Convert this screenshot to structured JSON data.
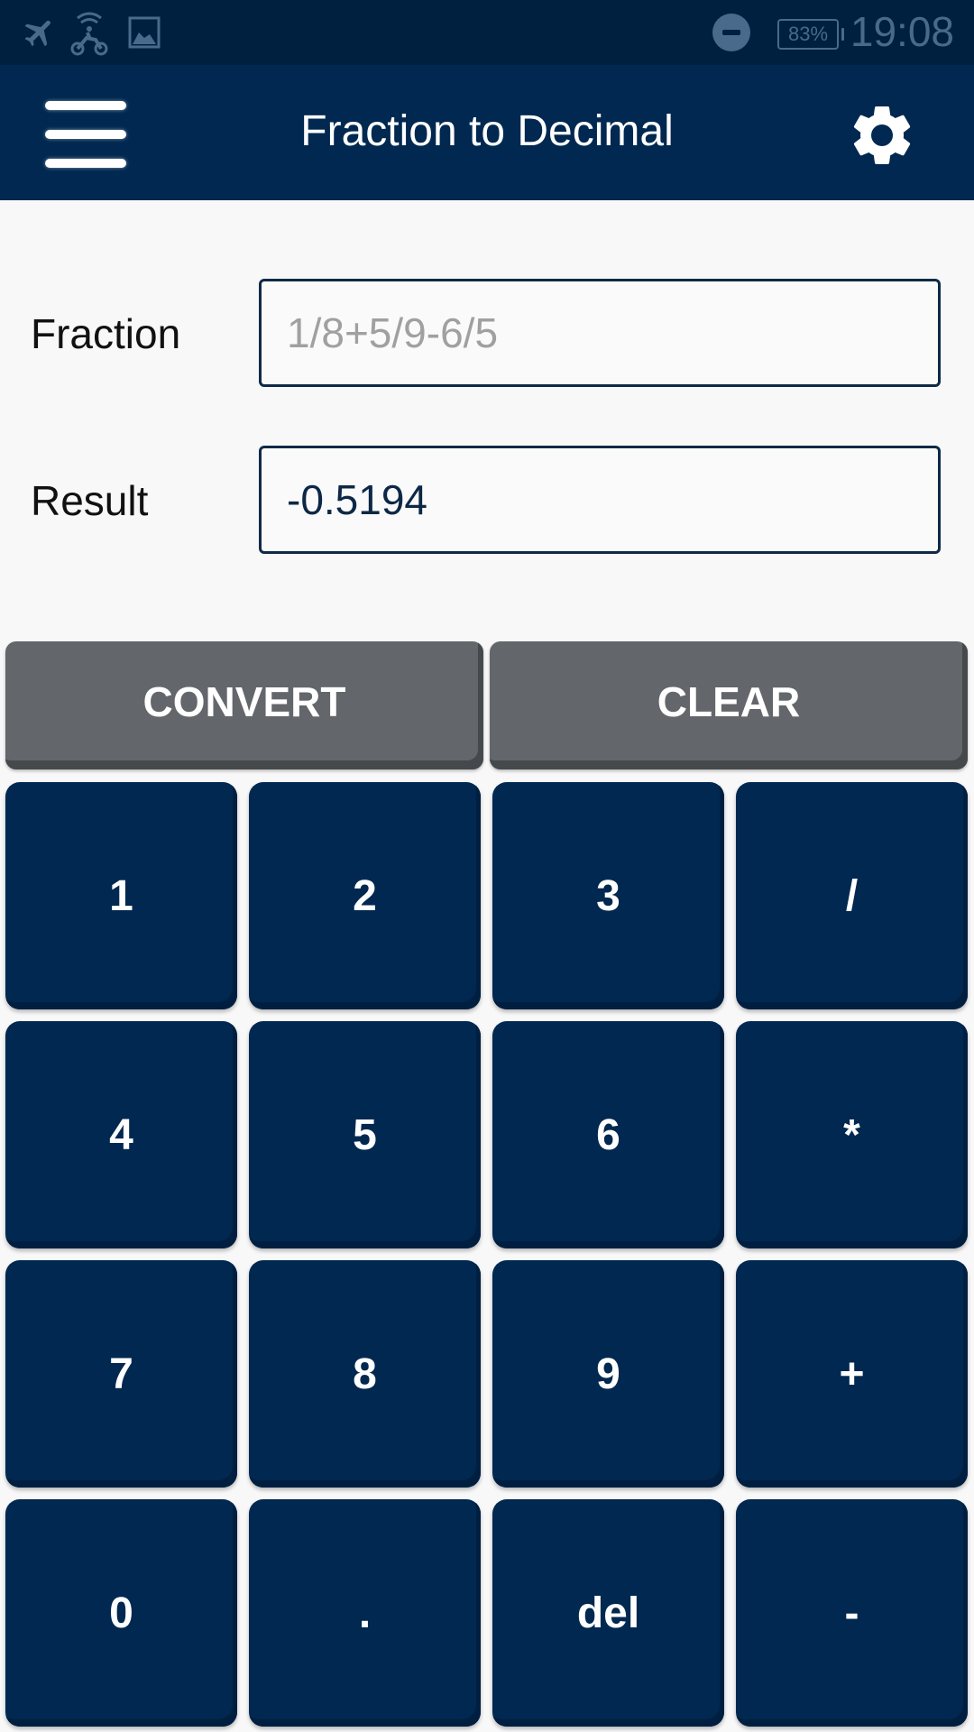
{
  "status_bar": {
    "icons": [
      "airplane-mode-icon",
      "wifi-hotspot-rider-icon",
      "image-icon",
      "do-not-disturb-icon"
    ],
    "battery": "83%",
    "time": "19:08"
  },
  "app_bar": {
    "title": "Fraction to Decimal",
    "menu_icon": "hamburger-menu-icon",
    "settings_icon": "gear-icon"
  },
  "form": {
    "fraction_label": "Fraction",
    "fraction_value": "",
    "fraction_placeholder": "1/8+5/9-6/5",
    "result_label": "Result",
    "result_value": "-0.5194"
  },
  "actions": {
    "convert": "CONVERT",
    "clear": "CLEAR"
  },
  "keypad": {
    "keys": [
      "1",
      "2",
      "3",
      "/",
      "4",
      "5",
      "6",
      "*",
      "7",
      "8",
      "9",
      "+",
      "0",
      ".",
      "del",
      "-"
    ]
  },
  "colors": {
    "primary": "#002850",
    "status_bar": "#00203f",
    "action_button": "#63666a",
    "background": "#f8f8f9"
  }
}
